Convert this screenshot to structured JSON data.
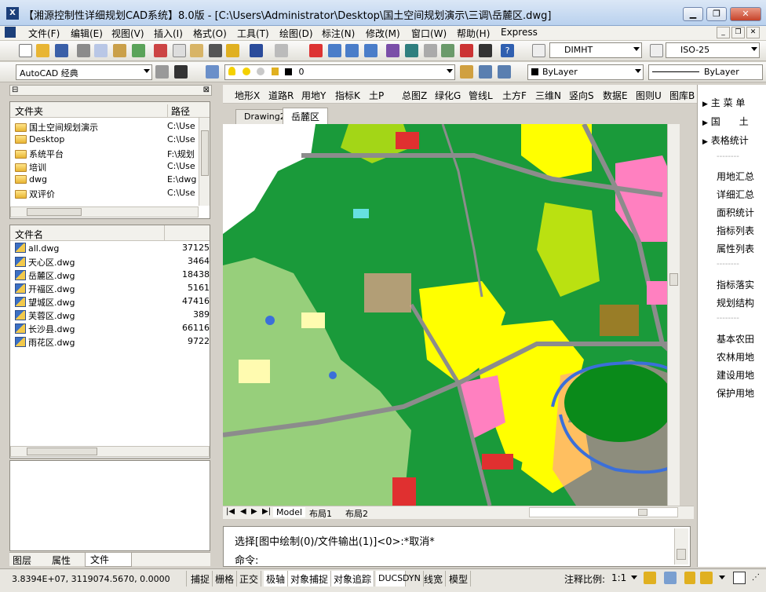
{
  "window": {
    "title": "【湘源控制性详细规划CAD系统】8.0版 - [C:\\Users\\Administrator\\Desktop\\国土空间规划演示\\三调\\岳麓区.dwg]",
    "app_icon": "app-logo-icon"
  },
  "menu": [
    "文件(F)",
    "编辑(E)",
    "视图(V)",
    "插入(I)",
    "格式(O)",
    "工具(T)",
    "绘图(D)",
    "标注(N)",
    "修改(M)",
    "窗口(W)",
    "帮助(H)",
    "Express"
  ],
  "toolbar": {
    "dimstyle": "DIMHT",
    "textstyle": "ISO-25",
    "workspace": "AutoCAD 经典",
    "layer": "0",
    "color": "ByLayer",
    "linetype": "ByLayer"
  },
  "left_panel": {
    "folder_header": {
      "col1": "文件夹",
      "col2": "路径"
    },
    "folders": [
      {
        "name": "国土空间规划演示",
        "path": "C:\\Use"
      },
      {
        "name": "Desktop",
        "path": "C:\\Use"
      },
      {
        "name": "系统平台",
        "path": "F:\\规划"
      },
      {
        "name": "培训",
        "path": "C:\\Use"
      },
      {
        "name": "dwg",
        "path": "E:\\dwg"
      },
      {
        "name": "双评价",
        "path": "C:\\Use"
      }
    ],
    "file_header": {
      "col1": "文件名",
      "col2": ""
    },
    "files": [
      {
        "name": "all.dwg",
        "size": "37125"
      },
      {
        "name": "天心区.dwg",
        "size": "3464"
      },
      {
        "name": "岳麓区.dwg",
        "size": "18438"
      },
      {
        "name": "开福区.dwg",
        "size": "5161"
      },
      {
        "name": "望城区.dwg",
        "size": "47416"
      },
      {
        "name": "芙蓉区.dwg",
        "size": "389"
      },
      {
        "name": "长沙县.dwg",
        "size": "66116"
      },
      {
        "name": "雨花区.dwg",
        "size": "9722"
      }
    ],
    "bottom_tabs": [
      "图层",
      "属性",
      "文件"
    ]
  },
  "cmd_menu": [
    "地形X",
    "道路R",
    "用地Y",
    "指标K",
    "土P",
    "总图Z",
    "绿化G",
    "管线L",
    "土方F",
    "三维N",
    "竖向S",
    "数据E",
    "图则U",
    "图库B"
  ],
  "doc_tabs": [
    "Drawing2",
    "岳麓区"
  ],
  "layout_tabs": [
    "Model",
    "布局1",
    "布局2"
  ],
  "command": {
    "line1": "选择[图中绘制(0)/文件输出(1)]<0>:*取消*",
    "prompt": "命令:"
  },
  "right_menu": {
    "items": [
      {
        "label": "主 菜 单",
        "arrow": true
      },
      {
        "label": "国　　土",
        "arrow": true
      },
      {
        "label": "表格统计",
        "arrow": true
      },
      {
        "label": "--------",
        "arrow": false
      },
      {
        "label": "用地汇总",
        "arrow": false
      },
      {
        "label": "详细汇总",
        "arrow": false
      },
      {
        "label": "面积统计",
        "arrow": false
      },
      {
        "label": "指标列表",
        "arrow": false
      },
      {
        "label": "属性列表",
        "arrow": false
      },
      {
        "label": "--------",
        "arrow": false
      },
      {
        "label": "指标落实",
        "arrow": false
      },
      {
        "label": "规划结构",
        "arrow": false
      },
      {
        "label": "--------",
        "arrow": false
      },
      {
        "label": "基本农田",
        "arrow": false
      },
      {
        "label": "农林用地",
        "arrow": false
      },
      {
        "label": "建设用地",
        "arrow": false
      },
      {
        "label": "保护用地",
        "arrow": false
      }
    ]
  },
  "status": {
    "coords": "3.8394E+07, 3119074.5670, 0.0000",
    "toggles": [
      "捕捉",
      "栅格",
      "正交",
      "极轴",
      "对象捕捉",
      "对象追踪",
      "DUCS",
      "DYN",
      "线宽",
      "模型"
    ],
    "scale_label": "注释比例:",
    "scale_value": "1:1"
  },
  "colors": {
    "forest": "#1a9a3a",
    "construction": "#ffff00",
    "commercial": "#ff80c0",
    "road": "#8c8c8c",
    "water": "#3b6fd9",
    "cultivated": "#ffffb0"
  }
}
